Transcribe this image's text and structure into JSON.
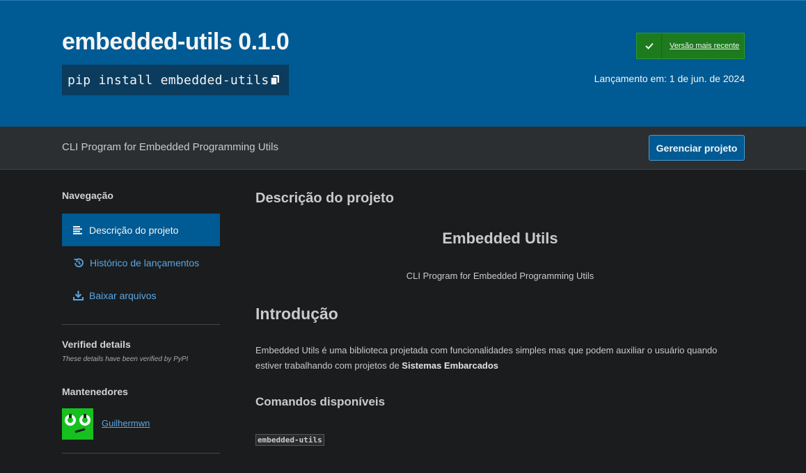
{
  "header": {
    "package_title": "embedded-utils 0.1.0",
    "pip_command": "pip install embedded-utils",
    "latest_badge_label": "Versão mais recente",
    "release_date": "Lançamento em: 1 de jun. de 2024"
  },
  "strip": {
    "summary": "CLI Program for Embedded Programming Utils",
    "manage_button": "Gerenciar projeto"
  },
  "sidebar": {
    "nav_heading": "Navegação",
    "nav_items": [
      {
        "label": "Descrição do projeto",
        "icon": "align-left-icon",
        "active": true
      },
      {
        "label": "Histórico de lançamentos",
        "icon": "history-icon",
        "active": false
      },
      {
        "label": "Baixar arquivos",
        "icon": "download-icon",
        "active": false
      }
    ],
    "verified_heading": "Verified details",
    "verified_note": "These details have been verified by PyPI",
    "maintainers_heading": "Mantenedores",
    "maintainer_name": "Guilhermwn"
  },
  "main": {
    "heading": "Descrição do projeto",
    "readme_title": "Embedded Utils",
    "readme_subtitle": "CLI Program for Embedded Programming Utils",
    "intro_heading": "Introdução",
    "intro_text": "Embedded Utils é uma biblioteca projetada com funcionalidades simples mas que podem auxiliar o usuário quando estiver trabalhando com projetos de ",
    "intro_bold": "Sistemas Embarcados",
    "commands_heading": "Comandos disponíveis",
    "command_code": "embedded-utils"
  },
  "colors": {
    "hero_blue": "#005a93",
    "badge_green": "#1d7a1d",
    "link_blue": "#5aa7e6",
    "background": "#1b1c1d"
  }
}
